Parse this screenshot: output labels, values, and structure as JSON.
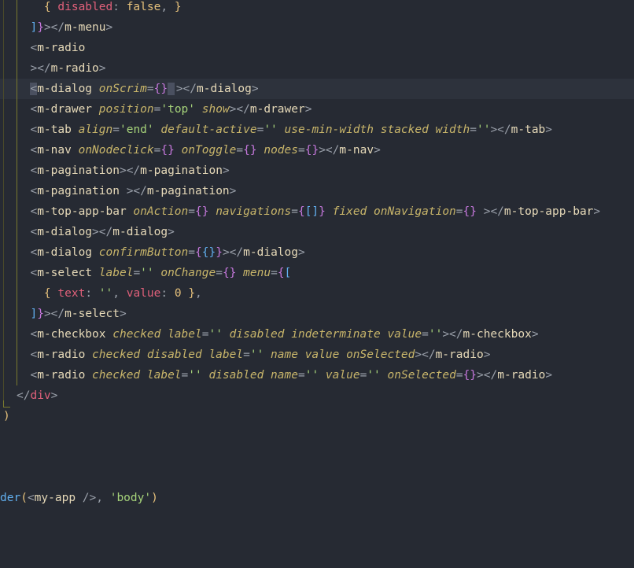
{
  "colors": {
    "background": "#262a33",
    "active_line": "#2d323c",
    "tag": "#e6d9b8",
    "punct": "#9aa0aa",
    "attr": "#c8b56a",
    "string": "#a6d37a",
    "key": "#e0607a",
    "brace": "#c678dd",
    "bracket": "#61afef",
    "number": "#e5c07b",
    "func": "#61afef"
  },
  "lines": [
    [
      {
        "t": "    ",
        "c": "plain"
      },
      {
        "t": "{ ",
        "c": "yel"
      },
      {
        "t": "disabled",
        "c": "key"
      },
      {
        "t": ": ",
        "c": "punct"
      },
      {
        "t": "false",
        "c": "num"
      },
      {
        "t": ", ",
        "c": "punct"
      },
      {
        "t": "}",
        "c": "yel"
      }
    ],
    [
      {
        "t": "  ",
        "c": "plain"
      },
      {
        "t": "]",
        "c": "bracket"
      },
      {
        "t": "}",
        "c": "brace"
      },
      {
        "t": "></",
        "c": "punct"
      },
      {
        "t": "m-menu",
        "c": "tag"
      },
      {
        "t": ">",
        "c": "punct"
      }
    ],
    [
      {
        "t": "  ",
        "c": "plain"
      },
      {
        "t": "<",
        "c": "punct"
      },
      {
        "t": "m-radio",
        "c": "tag"
      }
    ],
    [
      {
        "t": "  ",
        "c": "plain"
      },
      {
        "t": "></",
        "c": "punct"
      },
      {
        "t": "m-radio",
        "c": "tag"
      },
      {
        "t": ">",
        "c": "punct"
      }
    ],
    [
      {
        "t": "  ",
        "c": "plain"
      },
      {
        "t": "<",
        "c": "cur"
      },
      {
        "t": "m-dialog ",
        "c": "tag"
      },
      {
        "t": "onScrim",
        "c": "attr"
      },
      {
        "t": "=",
        "c": "punct"
      },
      {
        "t": "{}",
        "c": "brace"
      },
      {
        "t": " ",
        "c": "curblock"
      },
      {
        "t": "></",
        "c": "punct"
      },
      {
        "t": "m-dialog",
        "c": "tag"
      },
      {
        "t": ">",
        "c": "punct"
      }
    ],
    [
      {
        "t": "  ",
        "c": "plain"
      },
      {
        "t": "<",
        "c": "punct"
      },
      {
        "t": "m-drawer ",
        "c": "tag"
      },
      {
        "t": "position",
        "c": "attr"
      },
      {
        "t": "=",
        "c": "punct"
      },
      {
        "t": "'top'",
        "c": "str"
      },
      {
        "t": " ",
        "c": "plain"
      },
      {
        "t": "show",
        "c": "attr"
      },
      {
        "t": "></",
        "c": "punct"
      },
      {
        "t": "m-drawer",
        "c": "tag"
      },
      {
        "t": ">",
        "c": "punct"
      }
    ],
    [
      {
        "t": "  ",
        "c": "plain"
      },
      {
        "t": "<",
        "c": "punct"
      },
      {
        "t": "m-tab ",
        "c": "tag"
      },
      {
        "t": "align",
        "c": "attr"
      },
      {
        "t": "=",
        "c": "punct"
      },
      {
        "t": "'end'",
        "c": "str"
      },
      {
        "t": " ",
        "c": "plain"
      },
      {
        "t": "default-active",
        "c": "attr"
      },
      {
        "t": "=",
        "c": "punct"
      },
      {
        "t": "''",
        "c": "str"
      },
      {
        "t": " ",
        "c": "plain"
      },
      {
        "t": "use-min-width stacked width",
        "c": "attr"
      },
      {
        "t": "=",
        "c": "punct"
      },
      {
        "t": "''",
        "c": "str"
      },
      {
        "t": "></",
        "c": "punct"
      },
      {
        "t": "m-tab",
        "c": "tag"
      },
      {
        "t": ">",
        "c": "punct"
      }
    ],
    [
      {
        "t": "  ",
        "c": "plain"
      },
      {
        "t": "<",
        "c": "punct"
      },
      {
        "t": "m-nav ",
        "c": "tag"
      },
      {
        "t": "onNodeclick",
        "c": "attr"
      },
      {
        "t": "=",
        "c": "punct"
      },
      {
        "t": "{}",
        "c": "brace"
      },
      {
        "t": " ",
        "c": "plain"
      },
      {
        "t": "onToggle",
        "c": "attr"
      },
      {
        "t": "=",
        "c": "punct"
      },
      {
        "t": "{}",
        "c": "brace"
      },
      {
        "t": " ",
        "c": "plain"
      },
      {
        "t": "nodes",
        "c": "attr"
      },
      {
        "t": "=",
        "c": "punct"
      },
      {
        "t": "{}",
        "c": "brace"
      },
      {
        "t": "></",
        "c": "punct"
      },
      {
        "t": "m-nav",
        "c": "tag"
      },
      {
        "t": ">",
        "c": "punct"
      }
    ],
    [
      {
        "t": "  ",
        "c": "plain"
      },
      {
        "t": "<",
        "c": "punct"
      },
      {
        "t": "m-pagination",
        "c": "tag"
      },
      {
        "t": "></",
        "c": "punct"
      },
      {
        "t": "m-pagination",
        "c": "tag"
      },
      {
        "t": ">",
        "c": "punct"
      }
    ],
    [
      {
        "t": "  ",
        "c": "plain"
      },
      {
        "t": "<",
        "c": "punct"
      },
      {
        "t": "m-pagination ",
        "c": "tag"
      },
      {
        "t": "></",
        "c": "punct"
      },
      {
        "t": "m-pagination",
        "c": "tag"
      },
      {
        "t": ">",
        "c": "punct"
      }
    ],
    [
      {
        "t": "  ",
        "c": "plain"
      },
      {
        "t": "<",
        "c": "punct"
      },
      {
        "t": "m-top-app-bar ",
        "c": "tag"
      },
      {
        "t": "onAction",
        "c": "attr"
      },
      {
        "t": "=",
        "c": "punct"
      },
      {
        "t": "{}",
        "c": "brace"
      },
      {
        "t": " ",
        "c": "plain"
      },
      {
        "t": "navigations",
        "c": "attr"
      },
      {
        "t": "=",
        "c": "punct"
      },
      {
        "t": "{",
        "c": "brace"
      },
      {
        "t": "[]",
        "c": "bracket"
      },
      {
        "t": "}",
        "c": "brace"
      },
      {
        "t": " ",
        "c": "plain"
      },
      {
        "t": "fixed onNavigation",
        "c": "attr"
      },
      {
        "t": "=",
        "c": "punct"
      },
      {
        "t": "{}",
        "c": "brace"
      },
      {
        "t": " ",
        "c": "plain"
      },
      {
        "t": "></",
        "c": "punct"
      },
      {
        "t": "m-top-app-bar",
        "c": "tag"
      },
      {
        "t": ">",
        "c": "punct"
      }
    ],
    [
      {
        "t": "  ",
        "c": "plain"
      },
      {
        "t": "<",
        "c": "punct"
      },
      {
        "t": "m-dialog",
        "c": "tag"
      },
      {
        "t": "></",
        "c": "punct"
      },
      {
        "t": "m-dialog",
        "c": "tag"
      },
      {
        "t": ">",
        "c": "punct"
      }
    ],
    [
      {
        "t": "  ",
        "c": "plain"
      },
      {
        "t": "<",
        "c": "punct"
      },
      {
        "t": "m-dialog ",
        "c": "tag"
      },
      {
        "t": "confirmButton",
        "c": "attr"
      },
      {
        "t": "=",
        "c": "punct"
      },
      {
        "t": "{",
        "c": "brace"
      },
      {
        "t": "{}",
        "c": "bracket"
      },
      {
        "t": "}",
        "c": "brace"
      },
      {
        "t": "></",
        "c": "punct"
      },
      {
        "t": "m-dialog",
        "c": "tag"
      },
      {
        "t": ">",
        "c": "punct"
      }
    ],
    [
      {
        "t": "  ",
        "c": "plain"
      },
      {
        "t": "<",
        "c": "punct"
      },
      {
        "t": "m-select ",
        "c": "tag"
      },
      {
        "t": "label",
        "c": "attr"
      },
      {
        "t": "=",
        "c": "punct"
      },
      {
        "t": "''",
        "c": "str"
      },
      {
        "t": " ",
        "c": "plain"
      },
      {
        "t": "onChange",
        "c": "attr"
      },
      {
        "t": "=",
        "c": "punct"
      },
      {
        "t": "{}",
        "c": "brace"
      },
      {
        "t": " ",
        "c": "plain"
      },
      {
        "t": "menu",
        "c": "attr"
      },
      {
        "t": "=",
        "c": "punct"
      },
      {
        "t": "{",
        "c": "brace"
      },
      {
        "t": "[",
        "c": "bracket"
      }
    ],
    [
      {
        "t": "    ",
        "c": "plain"
      },
      {
        "t": "{ ",
        "c": "yel"
      },
      {
        "t": "text",
        "c": "key"
      },
      {
        "t": ": ",
        "c": "punct"
      },
      {
        "t": "''",
        "c": "str"
      },
      {
        "t": ", ",
        "c": "punct"
      },
      {
        "t": "value",
        "c": "key"
      },
      {
        "t": ": ",
        "c": "punct"
      },
      {
        "t": "0",
        "c": "num"
      },
      {
        "t": " ",
        "c": "plain"
      },
      {
        "t": "}",
        "c": "yel"
      },
      {
        "t": ",",
        "c": "punct"
      }
    ],
    [
      {
        "t": "  ",
        "c": "plain"
      },
      {
        "t": "]",
        "c": "bracket"
      },
      {
        "t": "}",
        "c": "brace"
      },
      {
        "t": "></",
        "c": "punct"
      },
      {
        "t": "m-select",
        "c": "tag"
      },
      {
        "t": ">",
        "c": "punct"
      }
    ],
    [
      {
        "t": "  ",
        "c": "plain"
      },
      {
        "t": "<",
        "c": "punct"
      },
      {
        "t": "m-checkbox ",
        "c": "tag"
      },
      {
        "t": "checked label",
        "c": "attr"
      },
      {
        "t": "=",
        "c": "punct"
      },
      {
        "t": "''",
        "c": "str"
      },
      {
        "t": " ",
        "c": "plain"
      },
      {
        "t": "disabled indeterminate value",
        "c": "attr"
      },
      {
        "t": "=",
        "c": "punct"
      },
      {
        "t": "''",
        "c": "str"
      },
      {
        "t": "></",
        "c": "punct"
      },
      {
        "t": "m-checkbox",
        "c": "tag"
      },
      {
        "t": ">",
        "c": "punct"
      }
    ],
    [
      {
        "t": "  ",
        "c": "plain"
      },
      {
        "t": "<",
        "c": "punct"
      },
      {
        "t": "m-radio ",
        "c": "tag"
      },
      {
        "t": "checked disabled label",
        "c": "attr"
      },
      {
        "t": "=",
        "c": "punct"
      },
      {
        "t": "''",
        "c": "str"
      },
      {
        "t": " ",
        "c": "plain"
      },
      {
        "t": "name value onSelected",
        "c": "attr"
      },
      {
        "t": "></",
        "c": "punct"
      },
      {
        "t": "m-radio",
        "c": "tag"
      },
      {
        "t": ">",
        "c": "punct"
      }
    ],
    [
      {
        "t": "  ",
        "c": "plain"
      },
      {
        "t": "<",
        "c": "punct"
      },
      {
        "t": "m-radio ",
        "c": "tag"
      },
      {
        "t": "checked label",
        "c": "attr"
      },
      {
        "t": "=",
        "c": "punct"
      },
      {
        "t": "''",
        "c": "str"
      },
      {
        "t": " ",
        "c": "plain"
      },
      {
        "t": "disabled name",
        "c": "attr"
      },
      {
        "t": "=",
        "c": "punct"
      },
      {
        "t": "''",
        "c": "str"
      },
      {
        "t": " ",
        "c": "plain"
      },
      {
        "t": "value",
        "c": "attr"
      },
      {
        "t": "=",
        "c": "punct"
      },
      {
        "t": "''",
        "c": "str"
      },
      {
        "t": " ",
        "c": "plain"
      },
      {
        "t": "onSelected",
        "c": "attr"
      },
      {
        "t": "=",
        "c": "punct"
      },
      {
        "t": "{}",
        "c": "brace"
      },
      {
        "t": "></",
        "c": "punct"
      },
      {
        "t": "m-radio",
        "c": "tag"
      },
      {
        "t": ">",
        "c": "punct"
      }
    ],
    [
      {
        "t": "",
        "c": "plain"
      },
      {
        "t": "</",
        "c": "punct"
      },
      {
        "t": "div",
        "c": "key"
      },
      {
        "t": ">",
        "c": "punct"
      }
    ],
    [
      {
        "t": ")",
        "c": "yel"
      }
    ],
    [],
    [],
    [],
    [
      {
        "t": "der",
        "c": "func"
      },
      {
        "t": "(",
        "c": "yel"
      },
      {
        "t": "<",
        "c": "punct"
      },
      {
        "t": "my-app ",
        "c": "tag"
      },
      {
        "t": "/>",
        "c": "punct"
      },
      {
        "t": ", ",
        "c": "punct"
      },
      {
        "t": "'body'",
        "c": "str"
      },
      {
        "t": ")",
        "c": "yel"
      }
    ]
  ]
}
